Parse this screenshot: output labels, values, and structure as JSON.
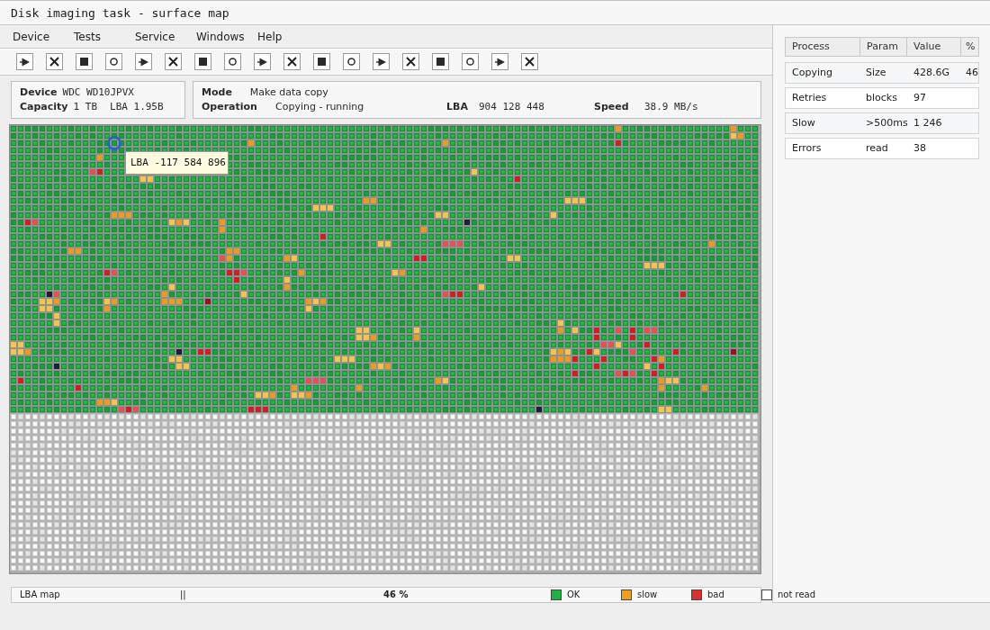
{
  "window": {
    "title": "Disk imaging task - surface map"
  },
  "menu": [
    "Device",
    "Tests",
    "Service",
    "Windows",
    "Help"
  ],
  "toolbar": [
    {
      "kind": "play"
    },
    {
      "kind": "cancel"
    },
    {
      "kind": "stop"
    },
    {
      "kind": "record"
    },
    {
      "kind": "play"
    },
    {
      "kind": "cancel"
    },
    {
      "kind": "stop"
    },
    {
      "kind": "record"
    },
    {
      "kind": "play"
    },
    {
      "kind": "cancel"
    },
    {
      "kind": "stop"
    },
    {
      "kind": "record"
    },
    {
      "kind": "play"
    },
    {
      "kind": "cancel"
    },
    {
      "kind": "stop"
    },
    {
      "kind": "record"
    },
    {
      "kind": "play"
    },
    {
      "kind": "cancel"
    }
  ],
  "device_panel": {
    "device": {
      "label": "Device",
      "value": "WDC WD10JPVX"
    },
    "capacity": {
      "label": "Capacity",
      "values": [
        "1 TB",
        "LBA 1.95B"
      ]
    }
  },
  "task_panel": {
    "mode": {
      "label": "Mode",
      "value": "Make data copy"
    },
    "operation": {
      "label": "Operation",
      "value": "Copying - running"
    },
    "lba": {
      "label": "LBA",
      "value": "904 128 448"
    },
    "speed": {
      "label": "Speed",
      "value": "38.9 MB/s"
    }
  },
  "surface_map": {
    "tooltip": "LBA -117 584 896"
  },
  "status_bar": {
    "label": "LBA map",
    "indicator": "||",
    "percent": "46 %",
    "legend": [
      {
        "label": "OK",
        "color": "#1fb141"
      },
      {
        "label": "slow",
        "color": "#f0a01e"
      },
      {
        "label": "bad",
        "color": "#d8312f"
      },
      {
        "label": "not read",
        "color": "#ffffff"
      }
    ]
  },
  "process_table": {
    "columns": [
      "Process",
      "Param",
      "Value",
      "%"
    ],
    "rows": [
      {
        "cells": [
          "Copying",
          "Size",
          "428.6G",
          "46"
        ]
      },
      {
        "cells": [
          "Retries",
          "blocks",
          "97"
        ]
      },
      {
        "cells": [
          "Slow",
          ">500ms",
          "1 246"
        ]
      },
      {
        "cells": [
          "Errors",
          "read",
          "38"
        ]
      }
    ]
  }
}
